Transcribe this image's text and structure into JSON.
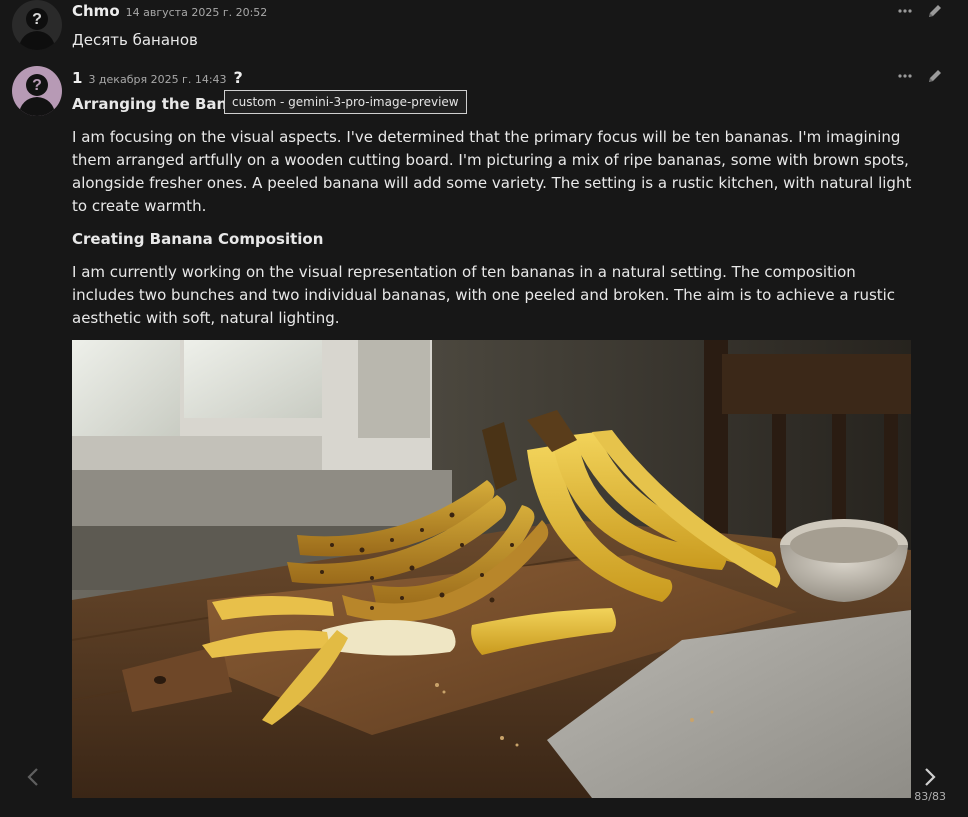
{
  "messages": [
    {
      "author": "Chmo",
      "timestamp": "14 августа 2025 г. 20:52",
      "text": "Десять бананов",
      "avatar_icon": "user-silhouette-question-icon"
    },
    {
      "author": "1",
      "timestamp": "3 декабря 2025 г. 14:43",
      "model_info_icon": "?",
      "tooltip": "custom - gemini-3-pro-image-preview",
      "heading_1": "Arranging the Banar",
      "paragraph_1": "I am focusing on the visual aspects. I've determined that the primary focus will be ten bananas. I'm imagining them arranged artfully on a wooden cutting board. I'm picturing a mix of ripe bananas, some with brown spots, alongside fresher ones. A peeled banana will add some variety. The setting is a rustic kitchen, with natural light to create warmth.",
      "heading_2": "Creating Banana Composition",
      "paragraph_2": "I am currently working on the visual representation of ten bananas in a natural setting. The composition includes two bunches and two individual bananas, with one peeled and broken. The aim is to achieve a rustic aesthetic with soft, natural lighting.",
      "image": "ten-bananas-on-wooden-cutting-board-photo"
    }
  ],
  "icons": {
    "more": "more-dots-icon",
    "edit": "pencil-icon",
    "prev": "chevron-left-icon",
    "next": "chevron-right-icon"
  },
  "pager": {
    "counter": "83/83"
  },
  "colors": {
    "background": "#171717",
    "text": "#e6e6e6",
    "muted": "#a8a8a8"
  }
}
